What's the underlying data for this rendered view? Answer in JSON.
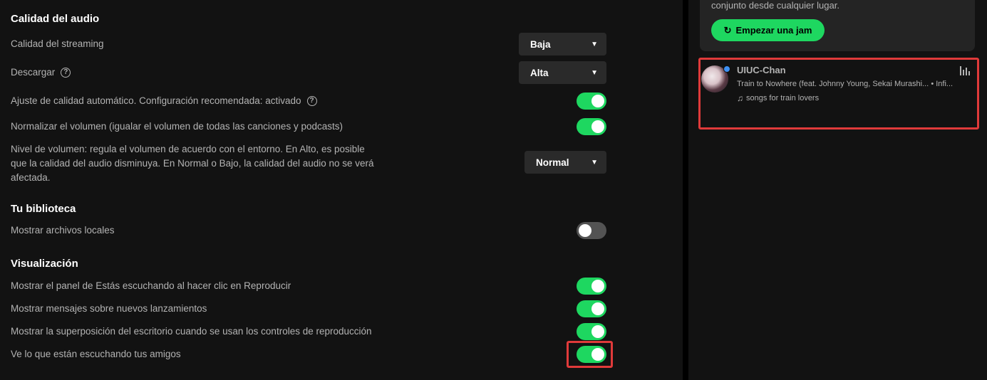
{
  "audio_quality": {
    "title": "Calidad del audio",
    "streaming_label": "Calidad del streaming",
    "streaming_value": "Baja",
    "download_label": "Descargar",
    "download_value": "Alta",
    "auto_adjust_label": "Ajuste de calidad automático. Configuración recomendada: activado",
    "normalize_label": "Normalizar el volumen (igualar el volumen de todas las canciones y podcasts)",
    "volume_level_line1": "Nivel de volumen: regula el volumen de acuerdo con el entorno. En Alto, es posible",
    "volume_level_line2": "que la calidad del audio disminuya. En Normal o Bajo, la calidad del audio no se verá",
    "volume_level_line3": "afectada.",
    "volume_level_value": "Normal"
  },
  "library": {
    "title": "Tu biblioteca",
    "local_files_label": "Mostrar archivos locales"
  },
  "display": {
    "title": "Visualización",
    "now_playing_label": "Mostrar el panel de Estás escuchando al hacer clic en Reproducir",
    "new_releases_label": "Mostrar mensajes sobre nuevos lanzamientos",
    "desktop_overlay_label": "Mostrar la superposición del escritorio cuando se usan los controles de reproducción",
    "friend_activity_label": "Ve lo que están escuchando tus amigos"
  },
  "toggles": {
    "auto_adjust": true,
    "normalize": true,
    "local_files": false,
    "now_playing": true,
    "new_releases": true,
    "desktop_overlay": true,
    "friend_activity": true
  },
  "jam": {
    "text": "conjunto desde cualquier lugar.",
    "button_label": "Empezar una jam"
  },
  "friend": {
    "name": "UIUC-Chan",
    "track": "Train to Nowhere (feat. Johnny Young, Sekai Murashi...",
    "artist_suffix": "• Infi...",
    "context": "songs for train lovers"
  },
  "colors": {
    "accent": "#1ed760",
    "highlight": "#e03a3a"
  },
  "icons": [
    "help-icon",
    "chevron-down-icon",
    "jam-icon",
    "equalizer-icon",
    "music-note-icon"
  ]
}
